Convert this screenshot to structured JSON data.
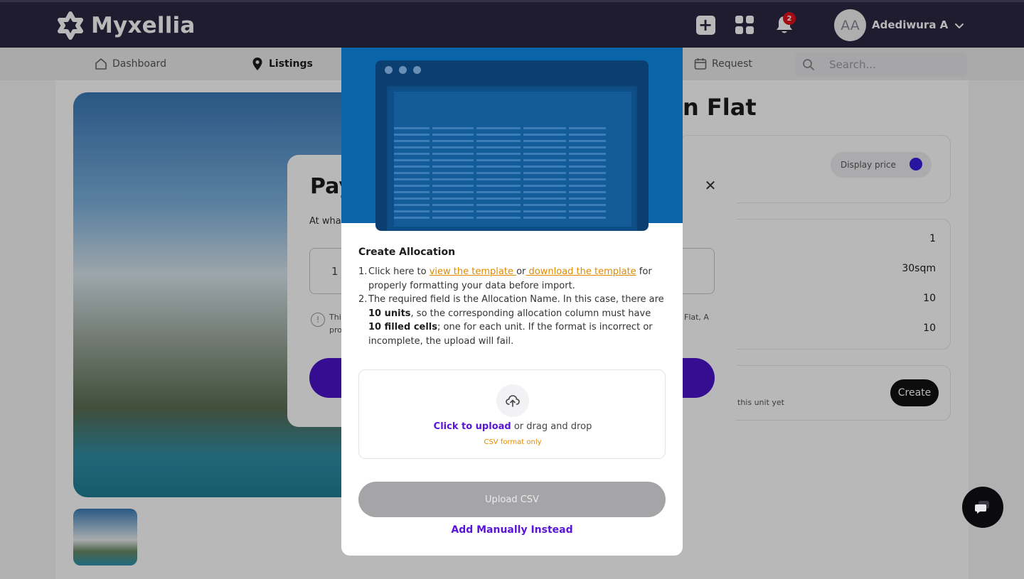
{
  "app": {
    "brand": "Myxellia",
    "notification_count": "2",
    "user_initials": "AA",
    "user_name": "Adediwura A"
  },
  "subnav": {
    "items": [
      {
        "label": "Dashboard",
        "icon": "home-icon"
      },
      {
        "label": "Listings",
        "icon": "map-pin-icon"
      },
      {
        "label": "Request",
        "icon": "calendar-icon"
      }
    ],
    "search_placeholder": "Search..."
  },
  "listing": {
    "title_fragment": "n Flat",
    "display_price_label": "Display price",
    "stats": [
      "1",
      "30sqm",
      "10",
      "10"
    ],
    "unit_note": "this unit yet",
    "create_label": "Create"
  },
  "back_modal": {
    "title_fragment": "Pay",
    "subtitle_fragment": "At wha",
    "input_value": "1",
    "info_fragment_a": "Thi",
    "info_fragment_b": "pro",
    "info_fragment_c": "Flat, A"
  },
  "allocation_modal": {
    "title": "Create Allocation",
    "step1": {
      "num": "1.",
      "before": "Click here to ",
      "view_link": "view the template ",
      "or": "or",
      "download_link": " download the template",
      "after": " for properly formatting your data before import."
    },
    "step2": {
      "num": "2.",
      "text_a": "The required field is the Allocation Name. In this case, there are ",
      "bold_a": "10 units",
      "text_b": ", so the corresponding allocation column must have ",
      "bold_b": "10 filled cells",
      "text_c": "; one for each unit. If the format is incorrect or incomplete, the upload will fail."
    },
    "upload": {
      "cta": "Click to upload",
      "rest": " or drag and drop",
      "format_note": "CSV format only"
    },
    "upload_button": "Upload CSV",
    "add_manually": "Add Manually Instead"
  },
  "colors": {
    "topbar": "#2a2740",
    "accent_purple": "#5a14d8",
    "link_orange": "#e08a00",
    "badge_red": "#e0101a",
    "illustration_blue": "#0a64a8"
  }
}
